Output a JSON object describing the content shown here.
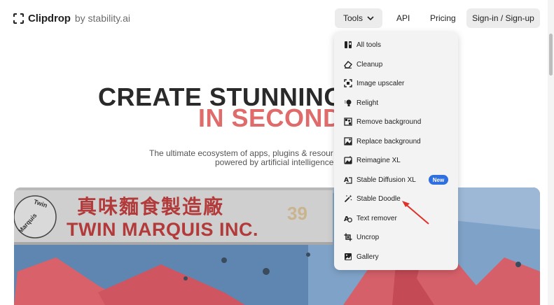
{
  "header": {
    "brand": "Clipdrop",
    "brand_suffix": "by stability.ai",
    "nav": {
      "tools": "Tools",
      "api": "API",
      "pricing": "Pricing",
      "signin": "Sign-in / Sign-up"
    }
  },
  "hero": {
    "title": "CREATE STUNNING",
    "subtitle": "IN SECOND",
    "desc_line1": "The ultimate ecosystem of apps, plugins & resour",
    "desc_line2": "powered by artificial intelligence"
  },
  "hero_image": {
    "sign_chinese": "真味麵食製造廠",
    "sign_english": "TWIN MARQUIS INC.",
    "sign_number": "39",
    "sign_logo_top": "Twin",
    "sign_logo_side": "Marquis"
  },
  "dropdown": {
    "items": [
      {
        "label": "All tools",
        "icon": "all-tools-icon"
      },
      {
        "label": "Cleanup",
        "icon": "eraser-icon"
      },
      {
        "label": "Image upscaler",
        "icon": "upscale-icon"
      },
      {
        "label": "Relight",
        "icon": "lightbulb-icon"
      },
      {
        "label": "Remove background",
        "icon": "remove-background-icon"
      },
      {
        "label": "Replace background",
        "icon": "replace-background-icon"
      },
      {
        "label": "Reimagine XL",
        "icon": "reimagine-icon"
      },
      {
        "label": "Stable Diffusion XL",
        "icon": "stable-diffusion-icon"
      },
      {
        "label": "Stable Doodle",
        "icon": "magic-wand-icon"
      },
      {
        "label": "Text remover",
        "icon": "text-remover-icon"
      },
      {
        "label": "Uncrop",
        "icon": "uncrop-icon"
      },
      {
        "label": "Gallery",
        "icon": "gallery-icon"
      }
    ],
    "new_badge": "New"
  },
  "colors": {
    "accent_red": "#e06b6b",
    "badge_blue": "#2f6fe0",
    "annotation_red": "#e0302a"
  }
}
